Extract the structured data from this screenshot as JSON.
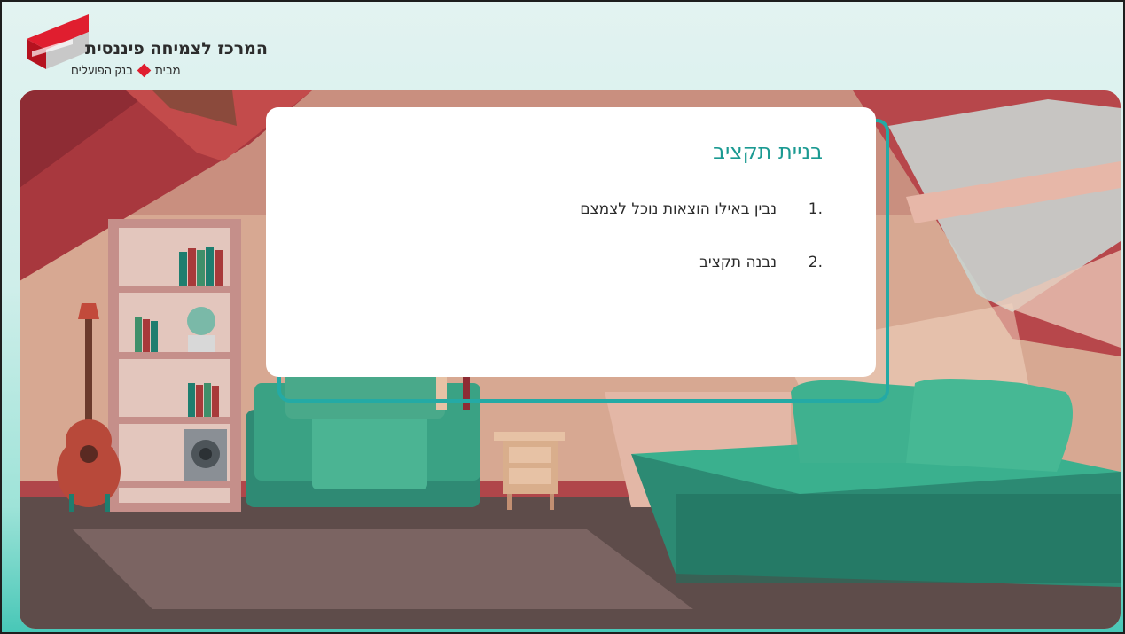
{
  "logo": {
    "title": "המרכז לצמיחה פיננסית",
    "subtitle_before": "מבית",
    "subtitle_after": "בנק הפועלים"
  },
  "card": {
    "title": "בניית תקציב",
    "items": [
      {
        "number": "1.",
        "text": "נבין באילו הוצאות נוכל לצמצם"
      },
      {
        "number": "2.",
        "text": "נבנה תקציב"
      }
    ]
  },
  "colors": {
    "accent": "#1b9a92",
    "frame": "#24aaa5",
    "logo_red": "#e01e2f"
  }
}
